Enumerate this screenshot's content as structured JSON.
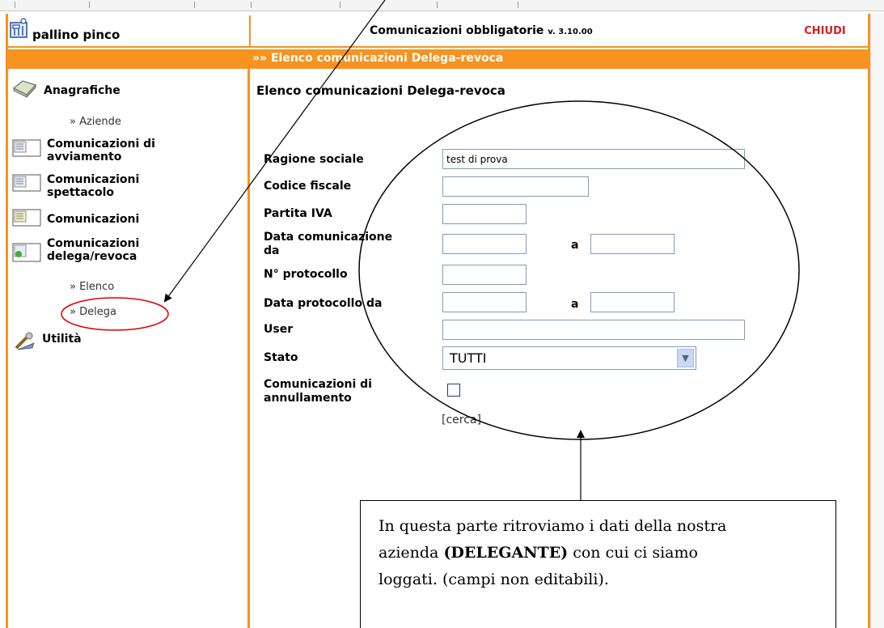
{
  "header": {
    "user": "pallino pinco",
    "app_title": "Comunicazioni obbligatorie",
    "version": "v. 3.10.00",
    "close_label": "CHIUDI"
  },
  "breadcrumb": "»» Elenco comunicazioni Delega-revoca",
  "sidebar": {
    "anagrafiche": "Anagrafiche",
    "aziende": "» Aziende",
    "avviamento_1": "Comunicazioni di",
    "avviamento_2": "avviamento",
    "spettacolo_1": "Comunicazioni",
    "spettacolo_2": "spettacolo",
    "comunicazioni": "Comunicazioni",
    "delega_1": "Comunicazioni",
    "delega_2": "delega/revoca",
    "elenco": "» Elenco",
    "delega": "» Delega",
    "utilita": "Utilità"
  },
  "main": {
    "page_title": "Elenco comunicazioni Delega-revoca",
    "form": {
      "ragione_sociale": {
        "label": "Ragione sociale",
        "value": "test di prova"
      },
      "codice_fiscale": {
        "label": "Codice fiscale",
        "value": ""
      },
      "partita_iva": {
        "label": "Partita IVA",
        "value": ""
      },
      "data_comunicazione": {
        "label_1": "Data comunicazione",
        "label_2": "da",
        "from": "",
        "to": ""
      },
      "protocollo": {
        "label": "N° protocollo",
        "value": ""
      },
      "data_protocollo": {
        "label": "Data protocollo da",
        "from": "",
        "to": ""
      },
      "user": {
        "label": "User",
        "value": ""
      },
      "stato": {
        "label": "Stato",
        "value": "TUTTI"
      },
      "annullamento": {
        "label_1": "Comunicazioni di",
        "label_2": "annullamento",
        "checked": false
      },
      "range_sep": "a",
      "search": "[cerca]"
    }
  },
  "callout": {
    "text_1": "In questa parte ritroviamo i dati della nostra",
    "text_2a": "azienda ",
    "text_2b": "(DELEGANTE)",
    "text_2c": " con cui ci siamo",
    "text_3": "loggati. (campi non editabili)."
  },
  "colors": {
    "accent_orange": "#f7931e",
    "close_red": "#d81e1e",
    "annotation_red": "#e00000"
  }
}
